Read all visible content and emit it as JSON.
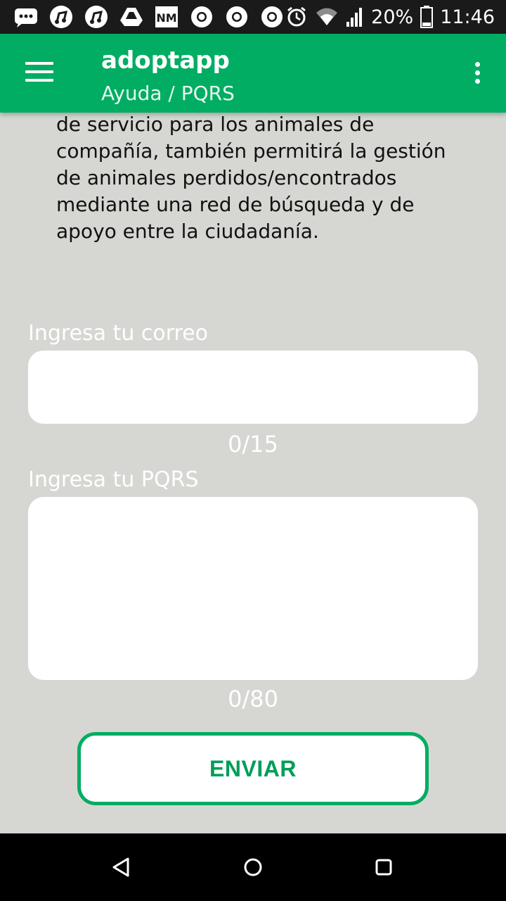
{
  "status_bar": {
    "battery": "20%",
    "time": "11:46",
    "icons": [
      "message-icon",
      "music-icon",
      "music-icon",
      "drive-icon",
      "nm-icon",
      "chrome-icon",
      "chrome-icon",
      "chrome-icon",
      "alarm-icon",
      "wifi-icon",
      "signal-icon",
      "battery-icon"
    ]
  },
  "app_bar": {
    "title": "adoptapp",
    "subtitle": "Ayuda / PQRS"
  },
  "content": {
    "description": "y ser voluntario en las jornadas\nde servicio para los animales de\ncompañía, también permitirá la gestión\nde animales perdidos/encontrados\nmediante una red de búsqueda y de\napoyo entre la ciudadanía.",
    "email_label": "Ingresa tu correo",
    "email_value": "",
    "email_counter": "0/15",
    "pqrs_label": "Ingresa tu PQRS",
    "pqrs_value": "",
    "pqrs_counter": "0/80",
    "send_button": "ENVIAR"
  },
  "colors": {
    "accent": "#00ad62",
    "background": "#d6d7d3"
  }
}
